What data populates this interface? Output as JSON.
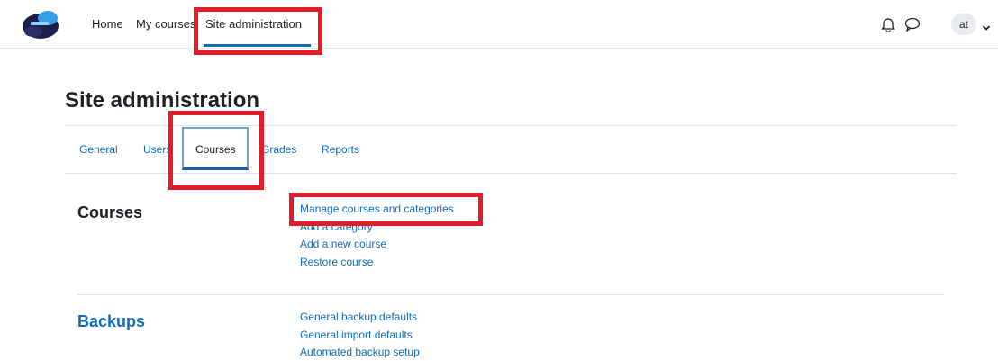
{
  "navbar": {
    "items": [
      {
        "label": "Home"
      },
      {
        "label": "My courses"
      },
      {
        "label": "Site administration"
      }
    ],
    "bell_icon": "bell-icon",
    "messages_icon": "speech-bubble-icon",
    "user_initials": "at",
    "dropdown_icon": "chevron-down-icon"
  },
  "page": {
    "title": "Site administration"
  },
  "tabs": [
    {
      "label": "General"
    },
    {
      "label": "Users"
    },
    {
      "label": "Courses"
    },
    {
      "label": "Grades"
    },
    {
      "label": "Reports"
    }
  ],
  "sections": [
    {
      "heading": "Courses",
      "links": [
        {
          "label": "Manage courses and categories"
        },
        {
          "label": "Add a category"
        },
        {
          "label": "Add a new course"
        },
        {
          "label": "Restore course"
        }
      ]
    },
    {
      "heading": "Backups",
      "links": [
        {
          "label": "General backup defaults"
        },
        {
          "label": "General import defaults"
        },
        {
          "label": "Automated backup setup"
        }
      ]
    }
  ],
  "colors": {
    "link": "#0f6cbf",
    "highlight": "#e21c28",
    "text": "#1d2125"
  }
}
